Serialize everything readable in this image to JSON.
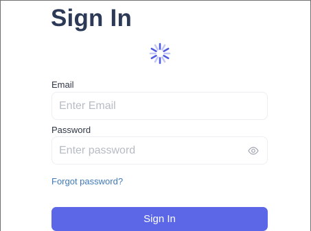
{
  "form": {
    "title": "Sign In",
    "email": {
      "label": "Email",
      "placeholder": "Enter Email",
      "value": ""
    },
    "password": {
      "label": "Password",
      "placeholder": "Enter password",
      "value": "",
      "toggle_icon": "eye-icon"
    },
    "forgot_password_label": "Forgot password?",
    "submit_label": "Sign In"
  },
  "loading_indicator": {
    "icon": "loading-spinner-icon"
  },
  "colors": {
    "title": "#2d3a57",
    "accent": "#5b67e6",
    "link": "#3d79b8",
    "spinner_dark": "#4f5be0",
    "spinner_light": "#c3c7f5"
  }
}
